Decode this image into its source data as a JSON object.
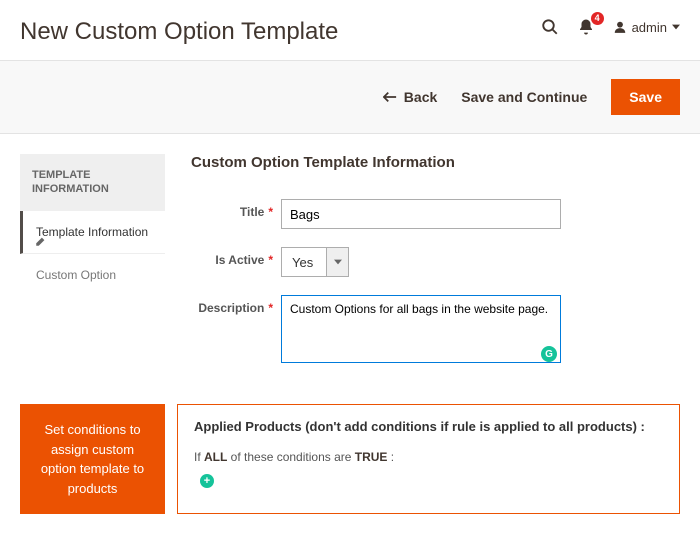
{
  "header": {
    "page_title": "New Custom Option Template",
    "notif_count": "4",
    "username": "admin"
  },
  "actions": {
    "back": "Back",
    "save_and_continue": "Save and Continue",
    "save": "Save"
  },
  "sidebar": {
    "heading": "TEMPLATE INFORMATION",
    "tab_info": "Template Information",
    "tab_option": "Custom Option"
  },
  "form": {
    "section_title": "Custom Option Template Information",
    "title_label": "Title",
    "title_value": "Bags",
    "active_label": "Is Active",
    "active_value": "Yes",
    "desc_label": "Description",
    "desc_value": "Custom Options for all bags in the website page."
  },
  "callout": {
    "text": "Set conditions to assign custom option template to products"
  },
  "applied": {
    "title": "Applied Products (don't add conditions if rule is applied to all products) :",
    "cond_prefix": "If ",
    "cond_all": "ALL",
    "cond_mid": " of these conditions are ",
    "cond_true": "TRUE",
    "cond_suffix": " :"
  }
}
